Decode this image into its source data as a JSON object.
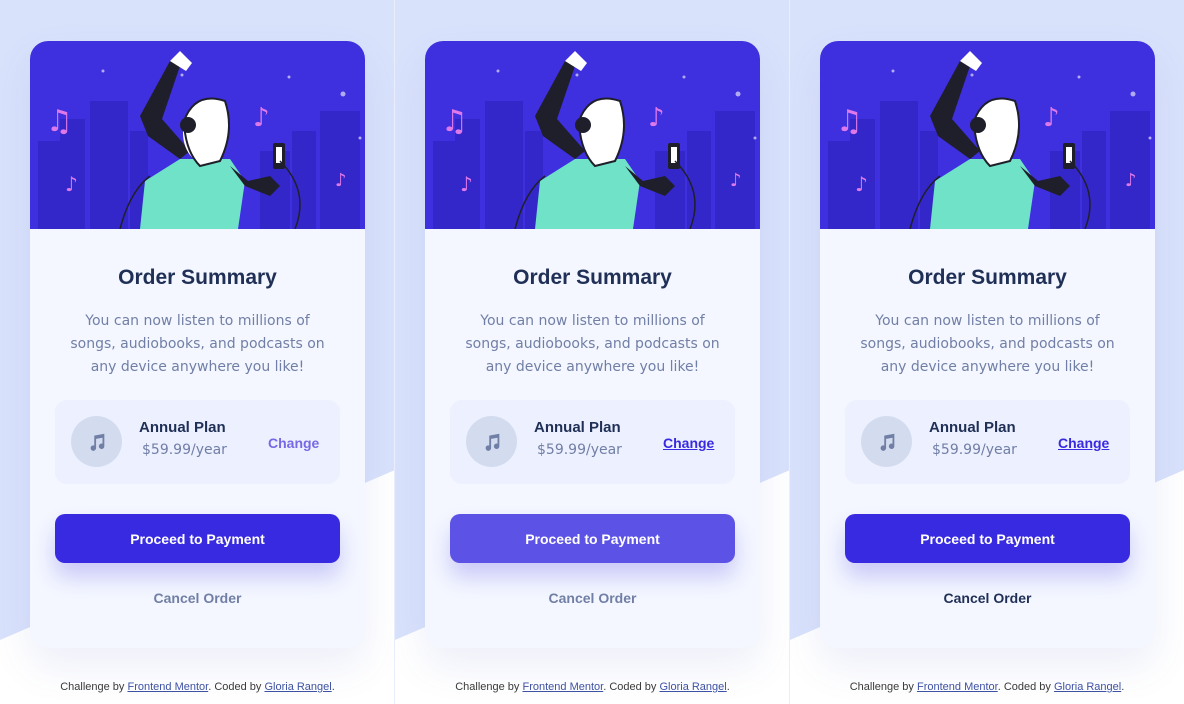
{
  "colors": {
    "page_bg": "#d9e2fb",
    "card_bg": "#f4f7ff",
    "hero_bg": "#3e2fdf",
    "primary": "#382ae1",
    "primary_hover": "#5c52e6",
    "heading": "#1f2f56",
    "muted": "#717fa6"
  },
  "panels": [
    {
      "state": "default",
      "card": {
        "title": "Order Summary",
        "description": "You can now listen to millions of songs, audiobooks, and podcasts on any device anywhere you like!",
        "plan": {
          "icon": "music-note-icon",
          "name": "Annual Plan",
          "price": "$59.99/year",
          "change_label": "Change"
        },
        "proceed_label": "Proceed to Payment",
        "cancel_label": "Cancel Order"
      },
      "attribution": {
        "prefix": "Challenge by ",
        "link1": "Frontend Mentor",
        "middle": ". Coded by ",
        "link2": "Gloria Rangel",
        "suffix": "."
      }
    },
    {
      "state": "hover",
      "card": {
        "title": "Order Summary",
        "description": "You can now listen to millions of songs, audiobooks, and podcasts on any device anywhere you like!",
        "plan": {
          "icon": "music-note-icon",
          "name": "Annual Plan",
          "price": "$59.99/year",
          "change_label": "Change"
        },
        "proceed_label": "Proceed to Payment",
        "cancel_label": "Cancel Order"
      },
      "attribution": {
        "prefix": "Challenge by ",
        "link1": "Frontend Mentor",
        "middle": ". Coded by ",
        "link2": "Gloria Rangel",
        "suffix": "."
      }
    },
    {
      "state": "active",
      "card": {
        "title": "Order Summary",
        "description": "You can now listen to millions of songs, audiobooks, and podcasts on any device anywhere you like!",
        "plan": {
          "icon": "music-note-icon",
          "name": "Annual Plan",
          "price": "$59.99/year",
          "change_label": "Change"
        },
        "proceed_label": "Proceed to Payment",
        "cancel_label": "Cancel Order"
      },
      "attribution": {
        "prefix": "Challenge by ",
        "link1": "Frontend Mentor",
        "middle": ". Coded by ",
        "link2": "Gloria Rangel",
        "suffix": "."
      }
    }
  ]
}
